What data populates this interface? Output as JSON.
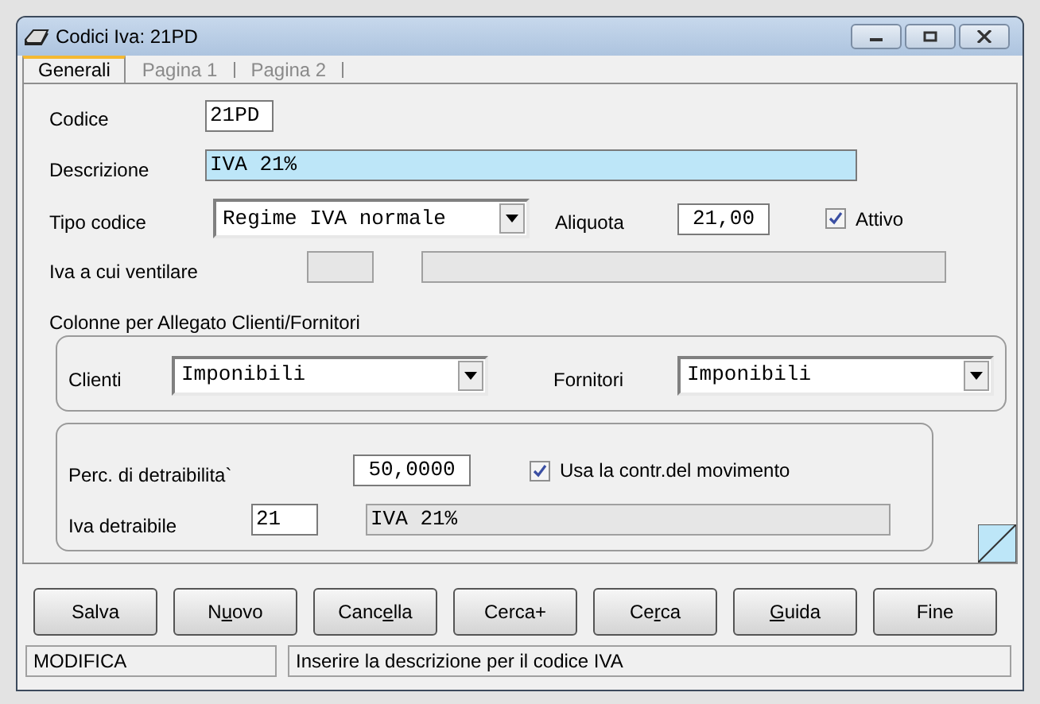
{
  "window": {
    "title": "Codici Iva: 21PD"
  },
  "tabs": [
    {
      "label": "Generali",
      "selected": true
    },
    {
      "label": "Pagina 1",
      "selected": false
    },
    {
      "label": "Pagina 2",
      "selected": false
    }
  ],
  "codice": {
    "label": "Codice",
    "value": "21PD"
  },
  "descrizione": {
    "label": "Descrizione",
    "value": "IVA 21%",
    "focused": true
  },
  "tipo_codice": {
    "label": "Tipo codice",
    "value": "Regime IVA normale"
  },
  "aliquota": {
    "label": "Aliquota",
    "value": "21,00"
  },
  "attivo": {
    "label": "Attivo",
    "checked": true
  },
  "iva_ventilare": {
    "label": "Iva a cui ventilare"
  },
  "allegato": {
    "title": "Colonne per Allegato Clienti/Fornitori",
    "clienti": {
      "label": "Clienti",
      "value": "Imponibili"
    },
    "fornitori": {
      "label": "Fornitori",
      "value": "Imponibili"
    }
  },
  "detraibilita": {
    "perc_label": "Perc. di detraibilita`",
    "perc_value": "50,0000",
    "usa_contr": {
      "label": "Usa la contr.del movimento",
      "checked": true
    },
    "iva_label": "Iva detraibile",
    "iva_code": "21",
    "iva_desc": "IVA 21%"
  },
  "buttons": [
    {
      "label_parts": [
        {
          "text": "Salva",
          "underlined": false
        }
      ]
    },
    {
      "label_parts": [
        {
          "text": "N",
          "underlined": false
        },
        {
          "text": "u",
          "underlined": true
        },
        {
          "text": "ovo",
          "underlined": false
        }
      ]
    },
    {
      "label_parts": [
        {
          "text": "Canc",
          "underlined": false
        },
        {
          "text": "e",
          "underlined": true
        },
        {
          "text": "lla",
          "underlined": false
        }
      ]
    },
    {
      "label_parts": [
        {
          "text": "Cerca+",
          "underlined": false
        }
      ]
    },
    {
      "label_parts": [
        {
          "text": "Ce",
          "underlined": false
        },
        {
          "text": "r",
          "underlined": true
        },
        {
          "text": "ca",
          "underlined": false
        }
      ]
    },
    {
      "label_parts": [
        {
          "text": "G",
          "underlined": true
        },
        {
          "text": "uida",
          "underlined": false
        }
      ]
    },
    {
      "label_parts": [
        {
          "text": "Fine",
          "underlined": false
        }
      ]
    }
  ],
  "status_bar": {
    "mode": "MODIFICA",
    "message": "Inserire la descrizione per il codice IVA"
  }
}
